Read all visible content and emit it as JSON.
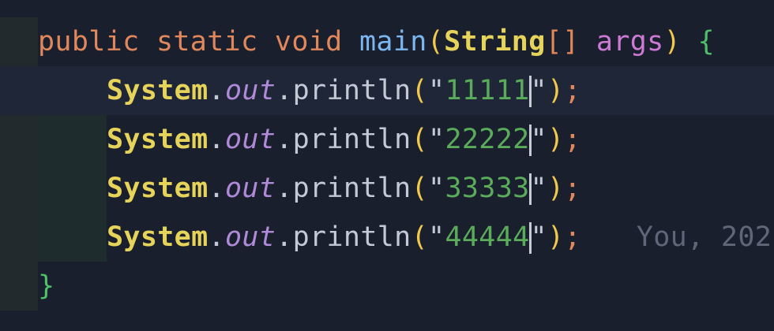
{
  "editor": {
    "signature": {
      "kw_public": "public",
      "kw_static": "static",
      "kw_void": "void",
      "method_name": "main",
      "open_paren": "(",
      "param_type": "String",
      "array_brackets": "[]",
      "param_name": "args",
      "close_paren": ")",
      "open_brace": "{"
    },
    "lines": [
      {
        "cls": "System",
        "field": "out",
        "method": "println",
        "value": "11111",
        "active": true
      },
      {
        "cls": "System",
        "field": "out",
        "method": "println",
        "value": "22222",
        "active": false
      },
      {
        "cls": "System",
        "field": "out",
        "method": "println",
        "value": "33333",
        "active": false
      },
      {
        "cls": "System",
        "field": "out",
        "method": "println",
        "value": "44444",
        "active": false
      }
    ],
    "blame_annotation": "You, 202",
    "closing_brace": "}"
  },
  "colors": {
    "background": "#1a1f2e",
    "keyword": "#e0875b",
    "function": "#7cb7f0",
    "type": "#e6d35a",
    "parameter": "#cc7ad4",
    "string": "#5aab5a",
    "brace": "#4fbf6a",
    "field": "#b08ad8"
  }
}
